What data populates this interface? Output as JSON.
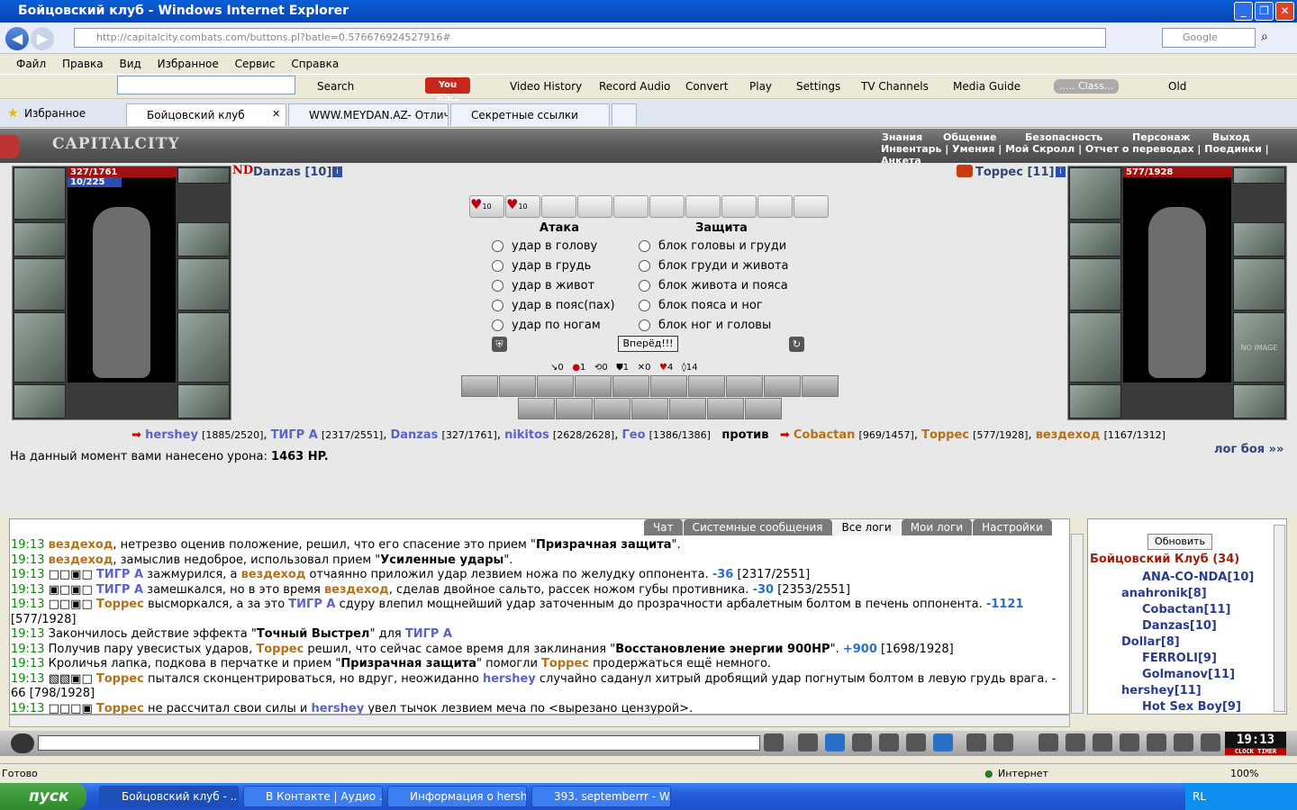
{
  "window": {
    "title": "Бойцовский клуб - Windows Internet Explorer"
  },
  "address": {
    "url": "http://capitalcity.combats.com/buttons.pl?batle=0.576676924527916#",
    "search_placeholder": "Google"
  },
  "menu": [
    "Файл",
    "Правка",
    "Вид",
    "Избранное",
    "Сервис",
    "Справка"
  ],
  "toolbar": {
    "search": "Search",
    "youtube": "You Tube",
    "video_history": "Video History",
    "record_audio": "Record Audio",
    "convert": "Convert",
    "play": "Play",
    "settings": "Settings",
    "tv_channels": "TV Channels",
    "media_guide": "Media Guide",
    "classic": "..... Class...",
    "old": "Old"
  },
  "tabs": {
    "favorites": "Избранное",
    "t1": "Бойцовский клуб",
    "t2": "WWW.MEYDAN.AZ- Отличн...",
    "t3": "Секретные ссылки"
  },
  "game": {
    "logo": "CAPITALCITY",
    "menu_top": [
      "Знания",
      "Общение",
      "Безопасность",
      "Персонаж",
      "Выход"
    ],
    "menu_bottom": "Инвентарь | Умения | Мой Скролл | Отчет о переводах | Поединки | Анкета",
    "left": {
      "clan": "ND",
      "name": "Danzas [10]",
      "hp": "327/1761",
      "mana": "10/225"
    },
    "right": {
      "name": "Торрес [11]",
      "hp": "577/1928",
      "no_image": "NO IMAGE"
    },
    "selected": [
      "10",
      "10"
    ],
    "attack_title": "Атака",
    "defense_title": "Защита",
    "attacks": [
      "удар в голову",
      "удар в грудь",
      "удар в живот",
      "удар в пояс(пах)",
      "удар по ногам"
    ],
    "defenses": [
      "блок головы и груди",
      "блок груди и живота",
      "блок живота и пояса",
      "блок пояса и ног",
      "блок ног и головы"
    ],
    "go_button": "Вперёд!!!",
    "counters": [
      "0",
      "1",
      "0",
      "1",
      "0",
      "4",
      "14"
    ],
    "vs": {
      "t1": [
        [
          "hershey",
          "[1885/2520]"
        ],
        [
          "ТИГР А",
          "[2317/2551]"
        ],
        [
          "Danzas",
          "[327/1761]"
        ],
        [
          "nikitos",
          "[2628/2628]"
        ],
        [
          "Гео",
          "[1386/1386]"
        ]
      ],
      "against": "против",
      "t2": [
        [
          "Cobactan",
          "[969/1457]"
        ],
        [
          "Торрес",
          "[577/1928]"
        ],
        [
          "вездеход",
          "[1167/1312]"
        ]
      ]
    },
    "damage_text": "На данный момент вами нанесено урона:",
    "damage_value": "1463 HP.",
    "log_link": "лог боя »»"
  },
  "logtabs": [
    "Чат",
    "Системные сообщения",
    "Все логи",
    "Мои логи",
    "Настройки"
  ],
  "log": [
    [
      "19:13",
      "",
      "вездеход",
      ", нетрезво оценив положение, решил, что его спасение это прием \"",
      "Призрачная защита",
      "\"."
    ],
    [
      "19:13",
      "",
      "вездеход",
      ", замыслив недоброе, использовал прием \"",
      "Усиленные удары",
      "\"."
    ],
    [
      "19:13",
      "□□▣□ ",
      "ТИГР А",
      " зажмурился, а ",
      "вездеход",
      " отчаянно приложил удар лезвием ножа по желудку оппонента. ",
      "-36",
      " [2317/2551]"
    ],
    [
      "19:13",
      "▣□▣□ ",
      "ТИГР А",
      " замешкался, но в это время ",
      "вездеход",
      ", сделав двойное сальто, рассек ножом губы противника. ",
      "-30",
      " [2353/2551]"
    ],
    [
      "19:13",
      "□□▣□ ",
      "Торрес",
      " высморкался, а за это ",
      "ТИГР А",
      " сдуру влепил мощнейший удар заточенным до прозрачности арбалетным болтом в печень оппонента. ",
      "-1121",
      ""
    ],
    [
      "",
      "",
      "",
      "[577/1928]"
    ],
    [
      "19:13",
      "Закончилось действие эффекта \"",
      "Точный Выстрел",
      "\" для ",
      "ТИГР А",
      ""
    ],
    [
      "19:13",
      "Получив пару увесистых ударов, ",
      "Торрес",
      " решил, что сейчас самое время для заклинания \"",
      "Восстановление энергии 900HP",
      "\". ",
      "+900",
      " [1698/1928]"
    ],
    [
      "19:13",
      "Кроличья лапка, подкова в перчатке и прием \"",
      "Призрачная защита",
      "\" помогли ",
      "Торрес",
      " продержаться ещё немного."
    ],
    [
      "19:13",
      "▧▧▣□ ",
      "Торрес",
      " пытался сконцентрироваться, но вдруг, неожиданно ",
      "hershey",
      " случайно саданул хитрый дробящий удар погнутым болтом в левую грудь врага. -"
    ],
    [
      "",
      "",
      "",
      "66 [798/1928]"
    ],
    [
      "19:13",
      "□□□▣ ",
      "Торрес",
      " не рассчитал свои силы и ",
      "hershey",
      " увел тычок лезвием меча по <вырезано цензурой>."
    ]
  ],
  "side": {
    "refresh": "Обновить",
    "title": "Бойцовский Клуб (34)",
    "players": [
      "ANA-CO-NDA[10]",
      "anahronik[8]",
      "Cobactan[11]",
      "Danzas[10]",
      "Dollar[8]",
      "FERROLI[9]",
      "Golmanov[11]",
      "hershey[11]",
      "Hot Sex Boy[9]"
    ]
  },
  "clock": "19:13",
  "clock_labels": [
    "CLOCK",
    "TIMER"
  ],
  "status": {
    "left": "Готово",
    "zone": "Интернет",
    "zoom": "100%"
  },
  "taskbar": {
    "start": "пуск",
    "items": [
      "Бойцовский клуб - ...",
      "В Контакте | Аудио ...",
      "Информация о hersh...",
      "393. septemberrr - W..."
    ],
    "lang": "RL"
  }
}
